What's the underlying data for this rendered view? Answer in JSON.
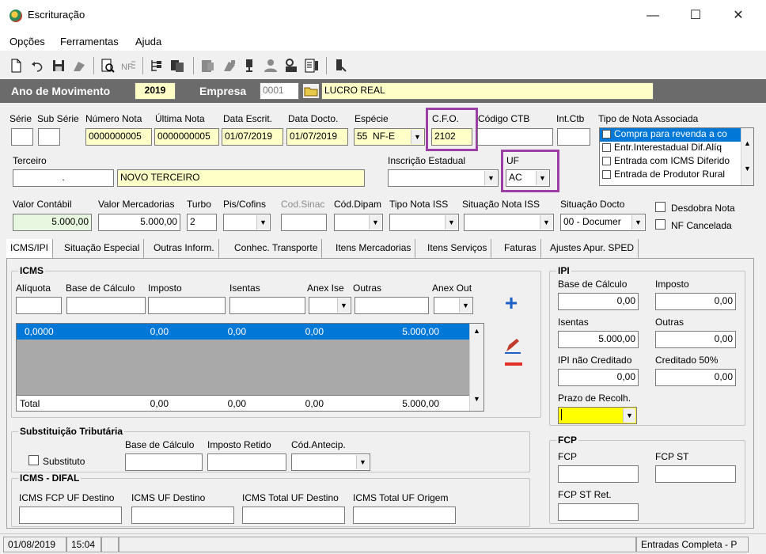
{
  "window": {
    "title": "Escrituração",
    "minimize": "—",
    "maximize": "☐",
    "close": "✕"
  },
  "menu": [
    "Opções",
    "Ferramentas",
    "Ajuda"
  ],
  "toolbar_icons": [
    "new-icon",
    "undo-icon",
    "save-icon",
    "delete-icon",
    "preview-icon",
    "nf-icon",
    "tree-icon",
    "copy-icon",
    "report-icon",
    "import-icon",
    "export-icon",
    "user-icon",
    "calculator-icon",
    "pages-icon",
    "exit-icon"
  ],
  "header": {
    "ano_label": "Ano de Movimento",
    "ano_value": "2019",
    "empresa_label": "Empresa",
    "empresa_code": "0001",
    "empresa_name": "LUCRO REAL"
  },
  "row1": {
    "labels": [
      "Série",
      "Sub Série",
      "Número Nota",
      "Última Nota",
      "Data Escrit.",
      "Data Docto.",
      "Espécie",
      "C.F.O.",
      "Código CTB",
      "Int.Ctb",
      "Tipo de Nota Associada"
    ],
    "numero_nota": "0000000005",
    "ultima_nota": "0000000005",
    "data_escrit": "01/07/2019",
    "data_docto": "01/07/2019",
    "especie_code": "55",
    "especie_name": "NF-E",
    "cfo": "2102"
  },
  "tipo_nota_associada": [
    {
      "label": "Compra para revenda a co",
      "selected": true
    },
    {
      "label": "Entr.Interestadual Dif.Alíq",
      "selected": false
    },
    {
      "label": "Entrada com ICMS Diferido",
      "selected": false
    },
    {
      "label": "Entrada de Produtor Rural",
      "selected": false
    }
  ],
  "row2": {
    "terceiro_label": "Terceiro",
    "terceiro_code": ".",
    "terceiro_name": "NOVO TERCEIRO",
    "inscricao_label": "Inscrição Estadual",
    "uf_label": "UF",
    "uf_value": "AC"
  },
  "row3": {
    "labels": [
      "Valor Contábil",
      "Valor Mercadorias",
      "Turbo",
      "Pis/Cofins",
      "Cod.Sinac",
      "Cód.Dipam",
      "Tipo Nota ISS",
      "Situação Nota ISS",
      "Situação Docto"
    ],
    "valor_contabil": "5.000,00",
    "valor_mercadorias": "5.000,00",
    "turbo": "2",
    "situacao_docto": "00 - Documer",
    "desdobra_nota": "Desdobra Nota",
    "nf_cancelada": "NF Cancelada"
  },
  "tabs": [
    "ICMS/IPI",
    "Situação Especial",
    "Outras Inform.",
    "Conhec. Transporte",
    "Itens Mercadorias",
    "Itens Serviços",
    "Faturas",
    "Ajustes Apur. SPED"
  ],
  "icms": {
    "title": "ICMS",
    "labels": [
      "Alíquota",
      "Base de Cálculo",
      "Imposto",
      "Isentas",
      "Anex Ise",
      "Outras",
      "Anex Out"
    ],
    "grid_row": [
      "0,0000",
      "0,00",
      "0,00",
      "0,00",
      "5.000,00"
    ],
    "total_label": "Total",
    "total_row": [
      "0,00",
      "0,00",
      "0,00",
      "5.000,00"
    ]
  },
  "ipi": {
    "title": "IPI",
    "base_label": "Base de Cálculo",
    "base_value": "0,00",
    "imposto_label": "Imposto",
    "imposto_value": "0,00",
    "isentas_label": "Isentas",
    "isentas_value": "5.000,00",
    "outras_label": "Outras",
    "outras_value": "0,00",
    "nao_cred_label": "IPI não Creditado",
    "nao_cred_value": "0,00",
    "cred50_label": "Creditado 50%",
    "cred50_value": "0,00",
    "prazo_label": "Prazo de Recolh."
  },
  "st": {
    "title": "Substituição Tributária",
    "substituto": "Substituto",
    "labels": [
      "Base de Cálculo",
      "Imposto Retido",
      "Cód.Antecip."
    ]
  },
  "difal": {
    "title": "ICMS - DIFAL",
    "labels": [
      "ICMS FCP UF Destino",
      "ICMS UF Destino",
      "ICMS Total UF Destino",
      "ICMS Total UF Origem"
    ]
  },
  "fcp": {
    "title": "FCP",
    "labels": [
      "FCP",
      "FCP ST",
      "FCP ST Ret."
    ]
  },
  "status": {
    "date": "01/08/2019",
    "time": "15:04",
    "right": "Entradas Completa - P"
  },
  "colors": {
    "highlight_border": "#9b3fa5",
    "selection": "#0078d7",
    "header_bar": "#6b6b6b"
  }
}
